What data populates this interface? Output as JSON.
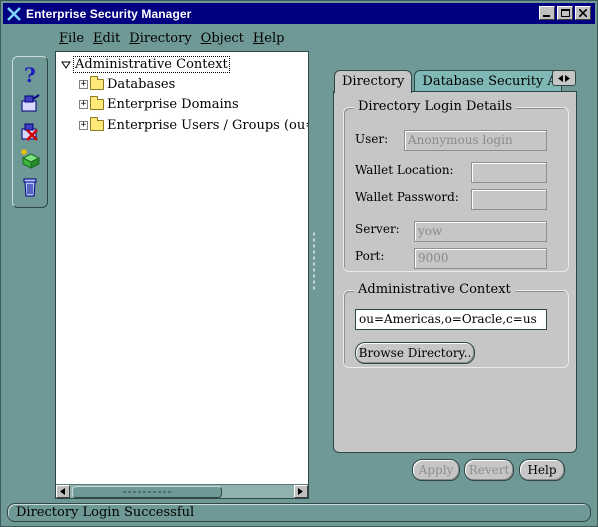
{
  "window": {
    "title": "Enterprise Security Manager"
  },
  "menu": [
    {
      "label": "File",
      "mnemonic": "F"
    },
    {
      "label": "Edit",
      "mnemonic": "E"
    },
    {
      "label": "Directory",
      "mnemonic": "D"
    },
    {
      "label": "Object",
      "mnemonic": "O"
    },
    {
      "label": "Help",
      "mnemonic": "H"
    }
  ],
  "toolbar": [
    {
      "icon": "help-icon"
    },
    {
      "icon": "connect-icon"
    },
    {
      "icon": "disconnect-icon"
    },
    {
      "icon": "create-icon"
    },
    {
      "icon": "trash-icon"
    }
  ],
  "tree": {
    "root": "Administrative Context",
    "items": [
      "Databases",
      "Enterprise Domains",
      "Enterprise Users / Groups (ou=Americ"
    ]
  },
  "tabs": {
    "active": "Directory",
    "inactive": "Database Security Adm..."
  },
  "login_group": {
    "title": "Directory Login Details",
    "user_label": "User:",
    "user_value": "Anonymous login",
    "wallet_location_label": "Wallet Location:",
    "wallet_location_value": "",
    "wallet_password_label": "Wallet Password:",
    "wallet_password_value": "",
    "server_label": "Server:",
    "server_value": "yow",
    "port_label": "Port:",
    "port_value": "9000"
  },
  "admin_group": {
    "title": "Administrative Context",
    "context_value": "ou=Americas,o=Oracle,c=us",
    "browse_label": "Browse Directory.."
  },
  "buttons": {
    "apply": "Apply",
    "revert": "Revert",
    "help": "Help"
  },
  "status": "Directory Login Successful"
}
